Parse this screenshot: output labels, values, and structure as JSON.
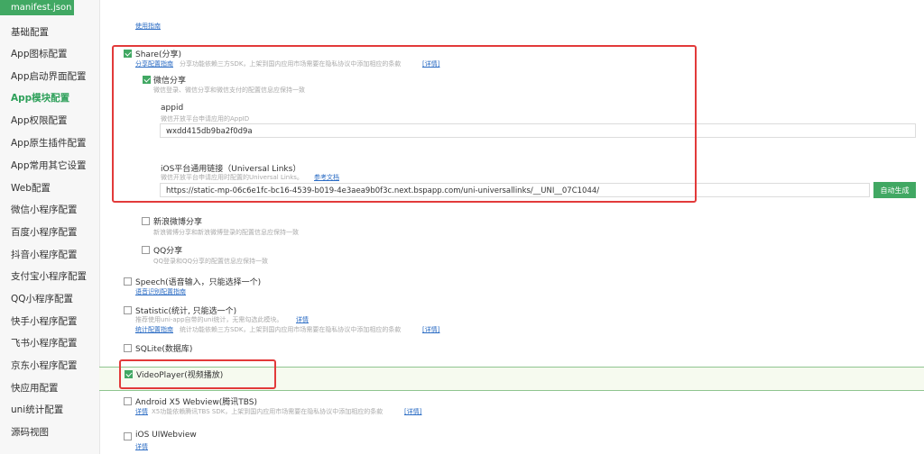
{
  "file_tab": "manifest.json",
  "sidebar": {
    "items": [
      {
        "label": "基础配置"
      },
      {
        "label": "App图标配置"
      },
      {
        "label": "App启动界面配置"
      },
      {
        "label": "App模块配置"
      },
      {
        "label": "App权限配置"
      },
      {
        "label": "App原生插件配置"
      },
      {
        "label": "App常用其它设置"
      },
      {
        "label": "Web配置"
      },
      {
        "label": "微信小程序配置"
      },
      {
        "label": "百度小程序配置"
      },
      {
        "label": "抖音小程序配置"
      },
      {
        "label": "支付宝小程序配置"
      },
      {
        "label": "QQ小程序配置"
      },
      {
        "label": "快手小程序配置"
      },
      {
        "label": "飞书小程序配置"
      },
      {
        "label": "京东小程序配置"
      },
      {
        "label": "快应用配置"
      },
      {
        "label": "uni统计配置"
      },
      {
        "label": "源码视图"
      }
    ],
    "active_index": 3
  },
  "top": {
    "link": "使用指南"
  },
  "share": {
    "title": "Share(分享)",
    "link": "分享配置指南",
    "desc": "分享功能依赖三方SDK，上架到国内应用市场需要在隐私协议中添加相应的条款",
    "detail_link": "[详情]",
    "wechat": {
      "title": "微信分享",
      "desc": "微信登录、微信分享和微信支付的配置信息应保持一致",
      "appid_label": "appid",
      "appid_hint": "微信开放平台申请应用的AppID",
      "appid_value": "wxdd415db9ba2f0d9a",
      "ul_label": "iOS平台通用链接（Universal Links）",
      "ul_hint": "微信开放平台申请应用时配置的Universal Links。",
      "ul_doc_link": "参考文档",
      "ul_value": "https://static-mp-06c6e1fc-bc16-4539-b019-4e3aea9b0f3c.next.bspapp.com/uni-universallinks/__UNI__07C1044/",
      "gen_button": "自动生成"
    },
    "weibo": {
      "title": "新浪微博分享",
      "desc": "新浪微博分享和新浪微博登录的配置信息应保持一致"
    },
    "qq": {
      "title": "QQ分享",
      "desc": "QQ登录和QQ分享的配置信息应保持一致"
    }
  },
  "speech": {
    "title": "Speech(语音输入，只能选择一个)",
    "link": "语音识别配置指南"
  },
  "statistic": {
    "title": "Statistic(统计, 只能选一个)",
    "desc": "推荐使用uni-app自带的uni统计，无需勾选此模块。",
    "detail_link": "详情",
    "link": "统计配置指南",
    "desc2": "统计功能依赖三方SDK，上架到国内应用市场需要在隐私协议中添加相应的条款",
    "detail_link2": "[详情]"
  },
  "sqlite": {
    "title": "SQLite(数据库)"
  },
  "videoplayer": {
    "title": "VideoPlayer(视频播放)"
  },
  "android_x5": {
    "title": "Android X5 Webview(腾讯TBS)",
    "detail_link": "详情",
    "desc": "X5功能依赖腾讯TBS SDK，上架到国内应用市场需要在隐私协议中添加相应的条款",
    "detail_link2": "[详情]"
  },
  "ios_uiwebview": {
    "title": "iOS UIWebview",
    "detail_link": "详情"
  }
}
